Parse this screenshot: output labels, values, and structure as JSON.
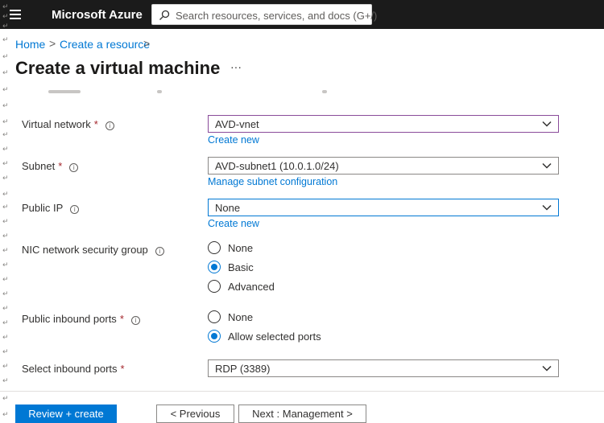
{
  "topbar": {
    "brand": "Microsoft Azure",
    "search_placeholder": "Search resources, services, and docs (G+/)"
  },
  "breadcrumb": {
    "home": "Home",
    "sep1": ">",
    "create_resource": "Create a resource",
    "sep2": ">"
  },
  "page": {
    "title": "Create a virtual machine",
    "more": "···"
  },
  "form": {
    "required_mark": "*",
    "info_glyph": "i",
    "virtual_network": {
      "label": "Virtual network",
      "value": "AVD-vnet",
      "link": "Create new"
    },
    "subnet": {
      "label": "Subnet",
      "value": "AVD-subnet1 (10.0.1.0/24)",
      "link": "Manage subnet configuration"
    },
    "public_ip": {
      "label": "Public IP",
      "value": "None",
      "link": "Create new"
    },
    "nic_nsg": {
      "label": "NIC network security group",
      "options": [
        "None",
        "Basic",
        "Advanced"
      ],
      "selected": "Basic"
    },
    "public_inbound_ports": {
      "label": "Public inbound ports",
      "options": [
        "None",
        "Allow selected ports"
      ],
      "selected": "Allow selected ports"
    },
    "select_inbound_ports": {
      "label": "Select inbound ports",
      "value": "RDP (3389)"
    }
  },
  "footer": {
    "review_create": "Review + create",
    "previous": "< Previous",
    "next": "Next : Management >"
  },
  "colors": {
    "accent": "#0078d4",
    "required": "#a4262c",
    "topbar": "#1b1b1b"
  },
  "icons": [
    "hamburger-icon",
    "search-icon",
    "info-icon",
    "chevron-down-icon"
  ]
}
